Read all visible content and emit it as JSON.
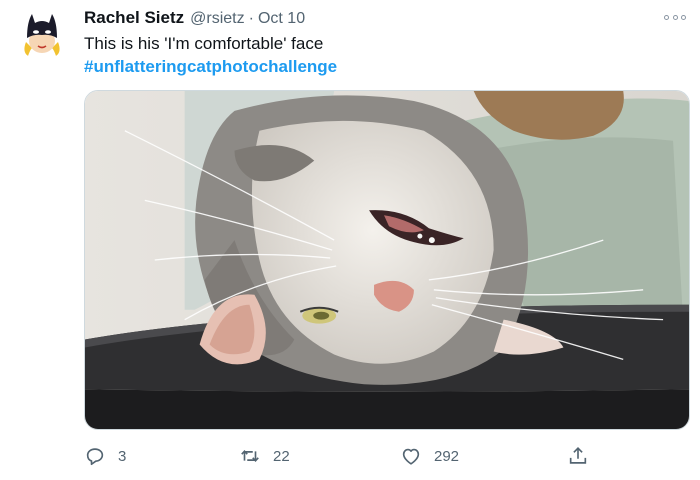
{
  "tweet": {
    "author_name": "Rachel Sietz",
    "handle": "@rsietz",
    "separator": "·",
    "date": "Oct 10",
    "text": "This is his 'I'm comfortable' face",
    "hashtag": "#unflatteringcatphotochallenge",
    "accent_color": "#1d9bf0",
    "avatar_icon": "batgirl-mask-avatar",
    "more_icon": "more-options-icon",
    "photo": {
      "subject": "upside-down grey and white cat on shelf"
    }
  },
  "actions": {
    "reply": {
      "icon": "reply-icon",
      "count": "3"
    },
    "retweet": {
      "icon": "retweet-icon",
      "count": "22"
    },
    "like": {
      "icon": "heart-icon",
      "count": "292"
    },
    "share": {
      "icon": "share-icon"
    }
  }
}
